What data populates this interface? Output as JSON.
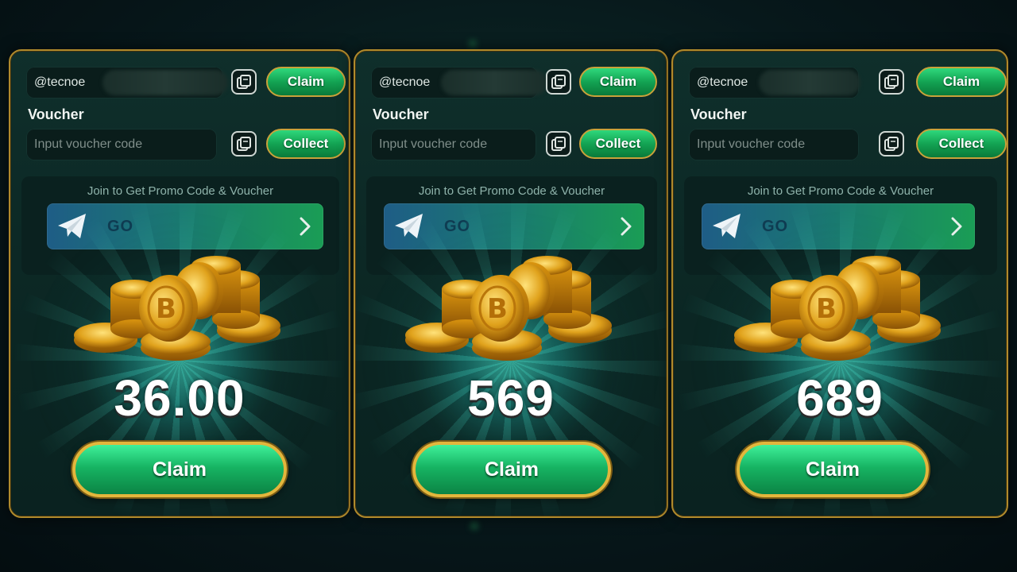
{
  "panels": [
    {
      "username": "@tecnoe",
      "claim_label": "Claim",
      "voucher_label": "Voucher",
      "voucher_placeholder": "Input voucher code",
      "collect_label": "Collect",
      "promo_text": "Join to Get Promo Code & Voucher",
      "go_label": "GO",
      "amount": "36.00",
      "main_claim_label": "Claim"
    },
    {
      "username": "@tecnoe",
      "claim_label": "Claim",
      "voucher_label": "Voucher",
      "voucher_placeholder": "Input voucher code",
      "collect_label": "Collect",
      "promo_text": "Join to Get Promo Code & Voucher",
      "go_label": "GO",
      "amount": "569",
      "main_claim_label": "Claim"
    },
    {
      "username": "@tecnoe",
      "claim_label": "Claim",
      "voucher_label": "Voucher",
      "voucher_placeholder": "Input voucher code",
      "collect_label": "Collect",
      "promo_text": "Join to Get Promo Code & Voucher",
      "go_label": "GO",
      "amount": "689",
      "main_claim_label": "Claim"
    }
  ],
  "icons": {
    "copy": "copy-icon",
    "telegram": "telegram-icon",
    "chevron": "chevron-right-icon",
    "coins": "gold-coins-icon"
  },
  "colors": {
    "gold_border": "#b08a2c",
    "button_green": "#17b463",
    "panel_bg": "#0b2623",
    "glow": "#50ffe6"
  }
}
